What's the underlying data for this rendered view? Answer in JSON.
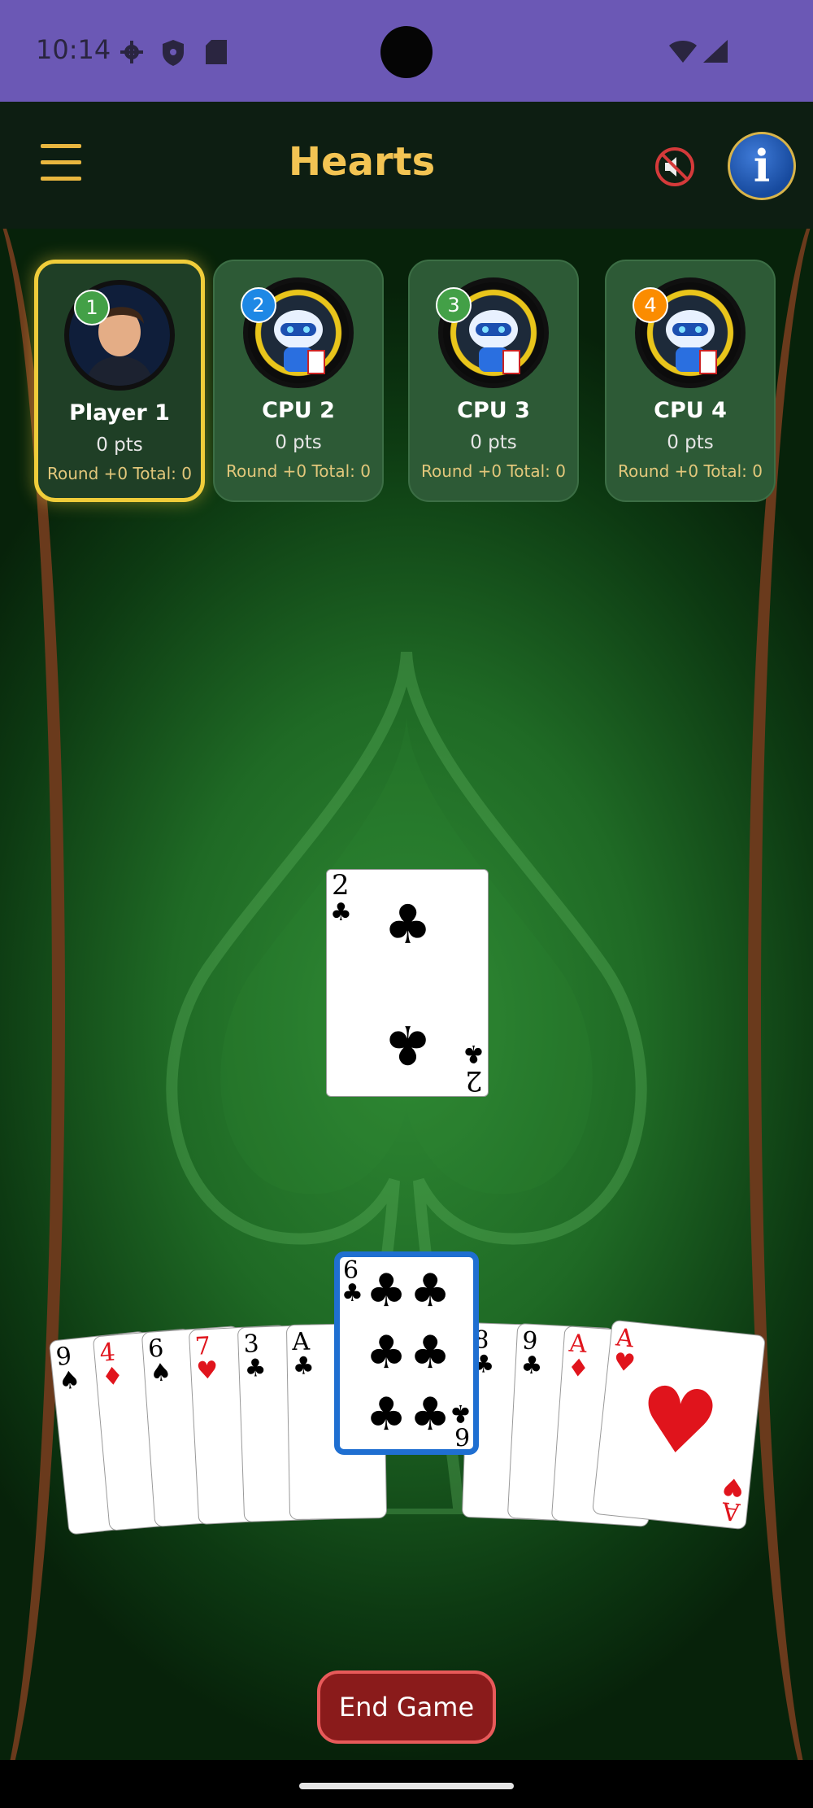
{
  "status_bar": {
    "time": "10:14",
    "icons": [
      "gear-icon",
      "shield-icon",
      "sd-card-icon",
      "wifi-icon",
      "signal-icon"
    ]
  },
  "header": {
    "title": "Hearts",
    "menu_icon": "hamburger-menu-icon",
    "mute_icon": "speaker-muted-icon",
    "info_label": "i"
  },
  "players": [
    {
      "badge": "1",
      "badge_color": "#43a047",
      "name": "Player 1",
      "points": "0 pts",
      "round_total": "Round +0  Total: 0",
      "active": true
    },
    {
      "badge": "2",
      "badge_color": "#1e88e5",
      "name": "CPU 2",
      "points": "0 pts",
      "round_total": "Round +0  Total: 0",
      "active": false
    },
    {
      "badge": "3",
      "badge_color": "#43a047",
      "name": "CPU 3",
      "points": "0 pts",
      "round_total": "Round +0  Total: 0",
      "active": false
    },
    {
      "badge": "4",
      "badge_color": "#fb8c00",
      "name": "CPU 4",
      "points": "0 pts",
      "round_total": "Round +0  Total: 0",
      "active": false
    }
  ],
  "trick": {
    "rank": "2",
    "suit": "♣"
  },
  "hand": {
    "selected": {
      "rank": "6",
      "suit": "♣"
    },
    "cards": [
      {
        "rank": "9",
        "suit": "♠"
      },
      {
        "rank": "4",
        "suit": "♦"
      },
      {
        "rank": "6",
        "suit": "♠"
      },
      {
        "rank": "7",
        "suit": "♥"
      },
      {
        "rank": "3",
        "suit": "♣"
      },
      {
        "rank": "A",
        "suit": "♣"
      },
      {
        "rank": "8",
        "suit": "♣"
      },
      {
        "rank": "9",
        "suit": "♣"
      },
      {
        "rank": "A",
        "suit": "♦"
      },
      {
        "rank": "A",
        "suit": "♥"
      }
    ]
  },
  "end_game_label": "End Game",
  "colors": {
    "accent": "#f3c453",
    "table_green": "#2f8a34",
    "selected_outline": "#1f6fd1",
    "end_button": "#8a1b1b"
  }
}
